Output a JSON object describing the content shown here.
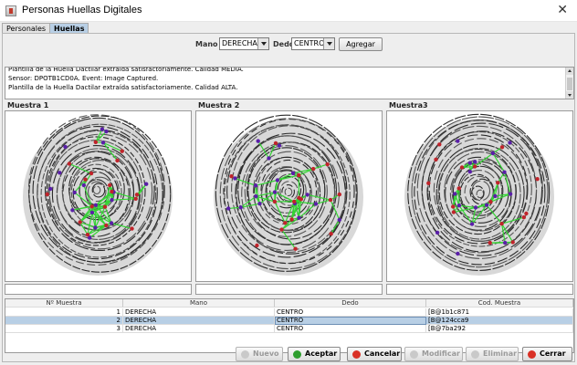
{
  "window": {
    "title": "Personas Huellas Digitales"
  },
  "tabs": [
    {
      "label": "Personales"
    },
    {
      "label": "Huellas"
    }
  ],
  "controls": {
    "mano_label": "Mano :",
    "mano_value": "DERECHA",
    "dedo_label": "Dedo:",
    "dedo_value": "CENTRO",
    "agregar_label": "Agregar"
  },
  "log": {
    "lines": [
      "Plantilla de la Huella Dactilar extraída satisfactoriamente. Calidad MEDIA.",
      "Sensor: DPOTB1CD0A. Event: Image Captured.",
      "Plantilla de la Huella Dactilar extraída satisfactoriamente. Calidad ALTA."
    ]
  },
  "samples": [
    {
      "title": "Muestra 1"
    },
    {
      "title": "Muestra 2"
    },
    {
      "title": "Muestra3"
    }
  ],
  "table": {
    "headers": [
      "Nº Muestra",
      "Mano",
      "Dedo",
      "Cod. Muestra"
    ],
    "rows": [
      {
        "n": "1",
        "mano": "DERECHA",
        "dedo": "CENTRO",
        "cod": "[B@1b1c871"
      },
      {
        "n": "2",
        "mano": "DERECHA",
        "dedo": "CENTRO",
        "cod": "[B@124cca9"
      },
      {
        "n": "3",
        "mano": "DERECHA",
        "dedo": "CENTRO",
        "cod": "[B@7ba292"
      }
    ],
    "selected_row": 2
  },
  "buttons": {
    "nuevo": "Nuevo",
    "aceptar": "Aceptar",
    "cancelar": "Cancelar",
    "modificar": "Modificar",
    "eliminar": "Eliminar",
    "cerrar": "Cerrar"
  },
  "colors": {
    "selection": "#b8cfe5",
    "minutia_line": "#33d433",
    "minutia_point_a": "#c0242b",
    "minutia_point_b": "#5a1fa8",
    "aceptar_icon": "#2e9e2e",
    "cancelar_icon": "#d93025",
    "cerrar_icon": "#d93025"
  }
}
